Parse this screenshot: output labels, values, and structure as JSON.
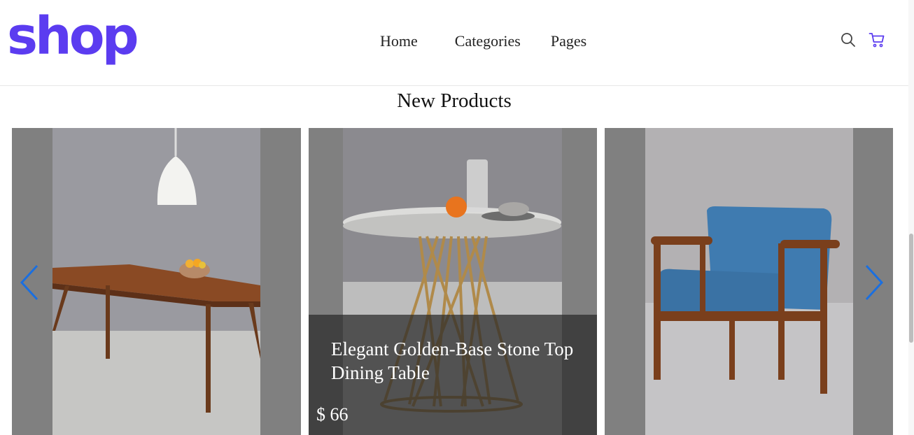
{
  "header": {
    "logo": "shop",
    "nav": [
      "Home",
      "Categories",
      "Pages"
    ],
    "icons": [
      "search-icon",
      "cart-icon"
    ]
  },
  "colors": {
    "brand": "#5b3cf0",
    "arrow": "#1a6fe0",
    "card_bg": "#808080"
  },
  "section": {
    "title": "New Products"
  },
  "products": [
    {
      "image": "wooden-dining-table-with-pendant-lamp"
    },
    {
      "image": "round-stone-table-gold-base",
      "name": "Elegant Golden-Base Stone Top Dining Table",
      "price": "$ 66"
    },
    {
      "image": "blue-upholstered-wooden-armchair"
    }
  ],
  "carousel": {
    "prev_icon": "chevron-left-icon",
    "next_icon": "chevron-right-icon"
  }
}
